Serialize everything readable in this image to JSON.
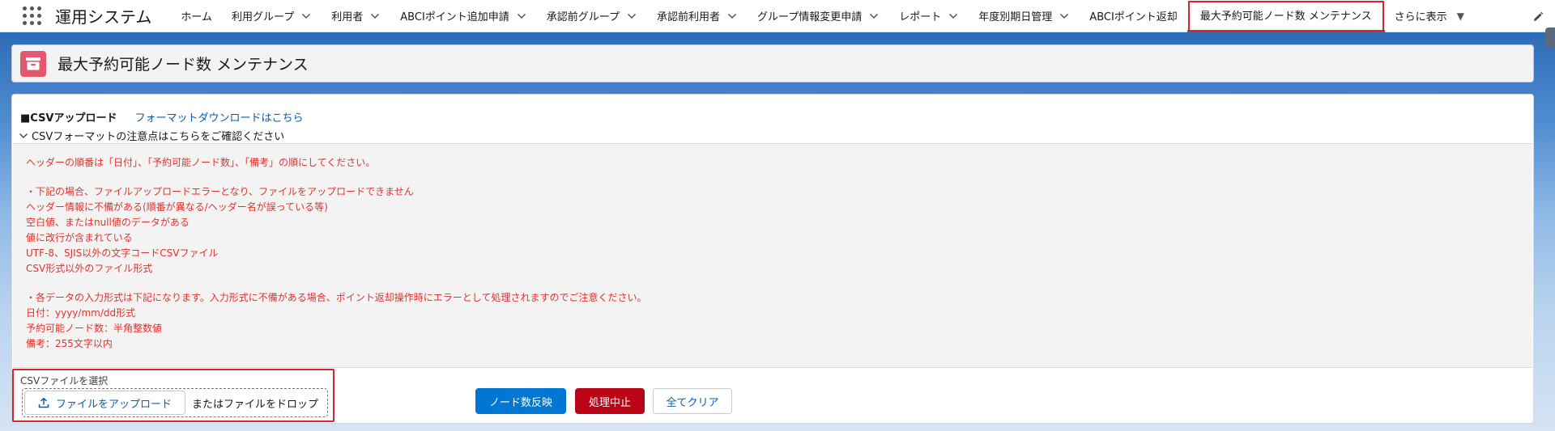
{
  "app": {
    "name": "運用システム"
  },
  "nav": {
    "items": [
      {
        "label": "ホーム",
        "has_menu": false
      },
      {
        "label": "利用グループ",
        "has_menu": true
      },
      {
        "label": "利用者",
        "has_menu": true
      },
      {
        "label": "ABCIポイント追加申請",
        "has_menu": true
      },
      {
        "label": "承認前グループ",
        "has_menu": true
      },
      {
        "label": "承認前利用者",
        "has_menu": true
      },
      {
        "label": "グループ情報変更申請",
        "has_menu": true
      },
      {
        "label": "レポート",
        "has_menu": true
      },
      {
        "label": "年度別期日管理",
        "has_menu": true
      },
      {
        "label": "ABCIポイント返却",
        "has_menu": false
      },
      {
        "label": "最大予約可能ノード数 メンテナンス",
        "has_menu": false,
        "active": true
      }
    ],
    "more_label": "さらに表示"
  },
  "page": {
    "title": "最大予約可能ノード数 メンテナンス"
  },
  "csv_section": {
    "title": "■CSVアップロード",
    "format_link": "フォーマットダウンロードはこちら",
    "notice_toggle": "CSVフォーマットの注意点はこちらをご確認ください",
    "notice_lines": [
      "ヘッダーの順番は「日付」、「予約可能ノード数」、「備考」の順にしてください。",
      "",
      "・下記の場合、ファイルアップロードエラーとなり、ファイルをアップロードできません",
      "ヘッダー情報に不備がある(順番が異なる/ヘッダー名が誤っている等)",
      "空白値、またはnull値のデータがある",
      "値に改行が含まれている",
      "UTF-8、SJIS以外の文字コードCSVファイル",
      "CSV形式以外のファイル形式",
      "",
      "・各データの入力形式は下記になります。入力形式に不備がある場合、ポイント返却操作時にエラーとして処理されますのでご注意ください。",
      "日付：yyyy/mm/dd形式",
      "予約可能ノード数：半角整数値",
      "備考：255文字以内"
    ]
  },
  "file_upload": {
    "label": "CSVファイルを選択",
    "button": "ファイルをアップロード",
    "drop_text": "またはファイルをドロップ"
  },
  "actions": {
    "apply": "ノード数反映",
    "cancel": "処理中止",
    "clear": "全てクリア"
  },
  "colors": {
    "brand": "#0176d3",
    "destructive": "#ba0517",
    "notice_text": "#e0332e",
    "highlight_outline": "#d7252f",
    "object_icon": "#e3586e"
  }
}
